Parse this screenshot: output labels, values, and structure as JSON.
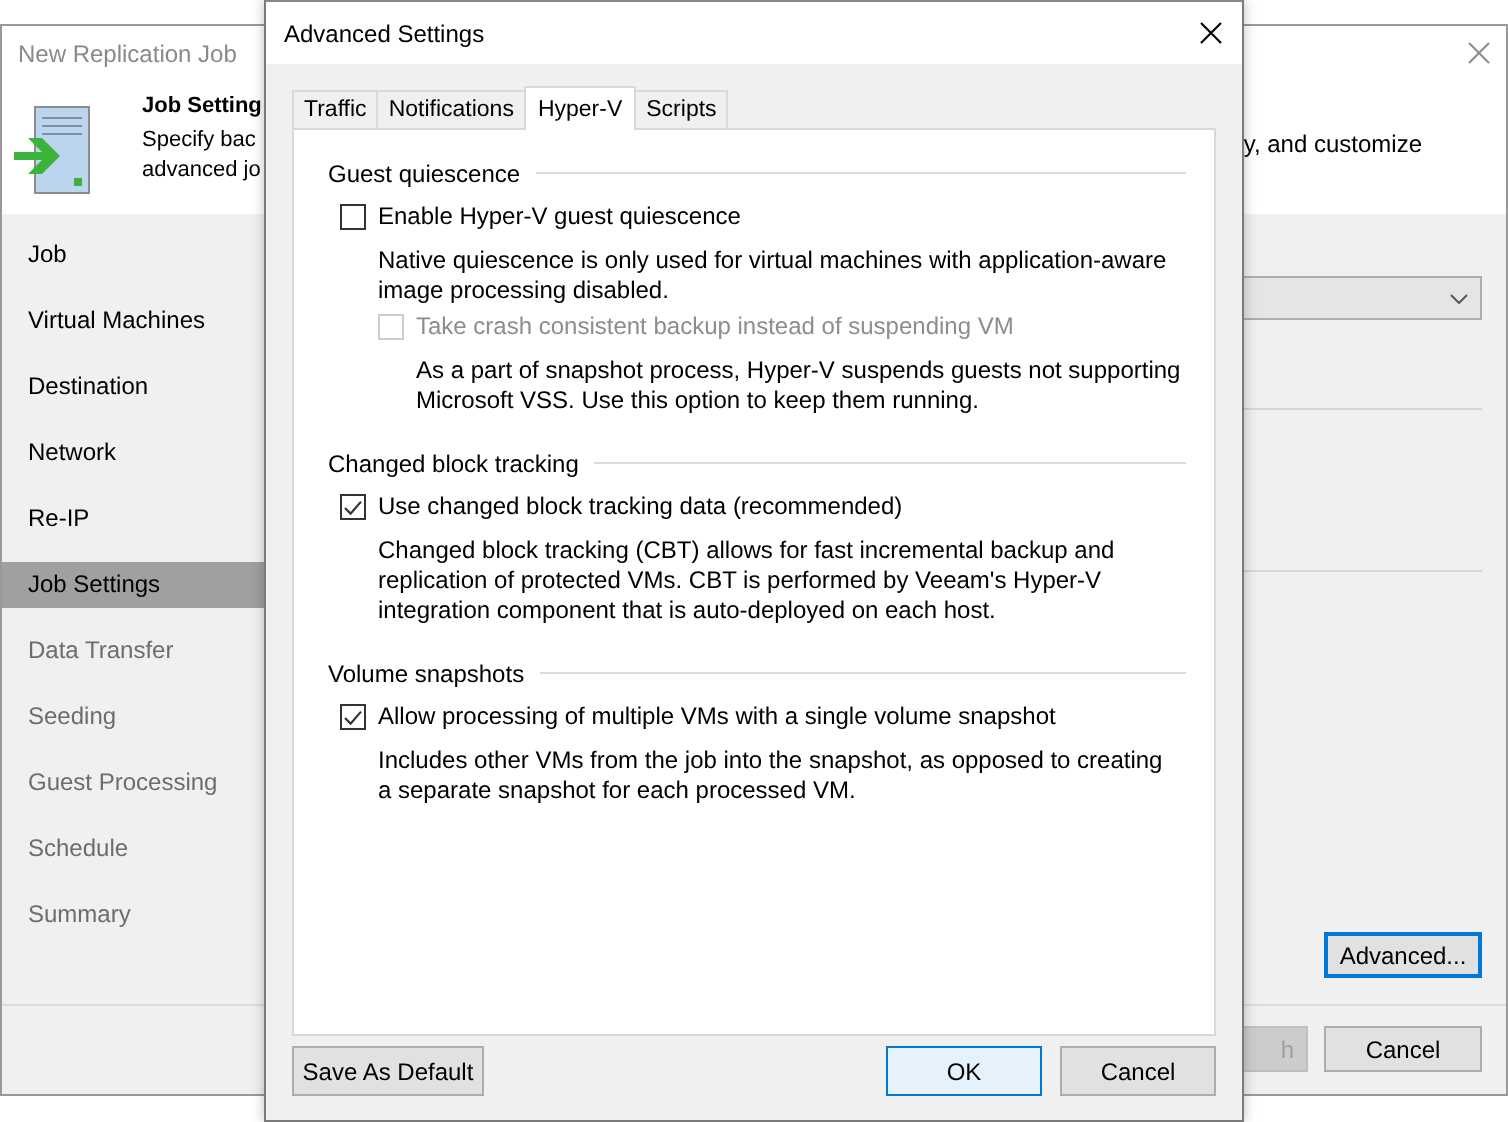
{
  "wizard": {
    "title": "New Replication Job",
    "header": {
      "title": "Job Setting",
      "description": [
        "Specify bac",
        "advanced jo"
      ],
      "description_right": "y, and customize"
    },
    "steps": [
      {
        "label": "Job",
        "selected": false,
        "disabled": false
      },
      {
        "label": "Virtual Machines",
        "selected": false,
        "disabled": false
      },
      {
        "label": "Destination",
        "selected": false,
        "disabled": false
      },
      {
        "label": "Network",
        "selected": false,
        "disabled": false
      },
      {
        "label": "Re-IP",
        "selected": false,
        "disabled": false
      },
      {
        "label": "Job Settings",
        "selected": true,
        "disabled": false
      },
      {
        "label": "Data Transfer",
        "selected": false,
        "disabled": true
      },
      {
        "label": "Seeding",
        "selected": false,
        "disabled": true
      },
      {
        "label": "Guest Processing",
        "selected": false,
        "disabled": true
      },
      {
        "label": "Schedule",
        "selected": false,
        "disabled": true
      },
      {
        "label": "Summary",
        "selected": false,
        "disabled": true
      }
    ],
    "advanced_button": {
      "label": "Advanced...",
      "focused": true
    },
    "footer_buttons": [
      {
        "label": "h",
        "disabled": true
      },
      {
        "label": "Cancel",
        "disabled": false
      }
    ]
  },
  "dialog": {
    "title": "Advanced Settings",
    "tabs": [
      {
        "label": "Traffic",
        "selected": false
      },
      {
        "label": "Notifications",
        "selected": false
      },
      {
        "label": "Hyper-V",
        "selected": true
      },
      {
        "label": "Scripts",
        "selected": false
      }
    ],
    "groups": [
      {
        "title": "Guest quiescence",
        "options": [
          {
            "label": "Enable Hyper-V guest quiescence",
            "checked": false,
            "disabled": false,
            "description": [
              "Native quiescence is only used for virtual machines with application-aware",
              "image processing disabled."
            ],
            "children": [
              {
                "label": "Take crash consistent backup instead of suspending VM",
                "checked": false,
                "disabled": true,
                "description": [
                  "As a part of snapshot process, Hyper-V suspends guests not supporting",
                  "Microsoft VSS. Use this option to keep them running."
                ]
              }
            ]
          }
        ]
      },
      {
        "title": "Changed block tracking",
        "options": [
          {
            "label": "Use changed block tracking data (recommended)",
            "checked": true,
            "disabled": false,
            "description": [
              "Changed block tracking (CBT) allows for fast incremental backup and",
              "replication of protected VMs. CBT is performed by Veeam's Hyper-V",
              "integration component that is auto-deployed on each host."
            ]
          }
        ]
      },
      {
        "title": "Volume snapshots",
        "options": [
          {
            "label": "Allow processing of multiple VMs with a single volume snapshot",
            "checked": true,
            "disabled": false,
            "description": [
              "Includes other VMs from the job into the snapshot, as opposed to creating",
              "a separate snapshot for each processed VM."
            ]
          }
        ]
      }
    ],
    "buttons": [
      {
        "label": "Save As Default",
        "kind": "secondary"
      },
      {
        "label": "OK",
        "kind": "default"
      },
      {
        "label": "Cancel",
        "kind": "normal"
      }
    ]
  }
}
